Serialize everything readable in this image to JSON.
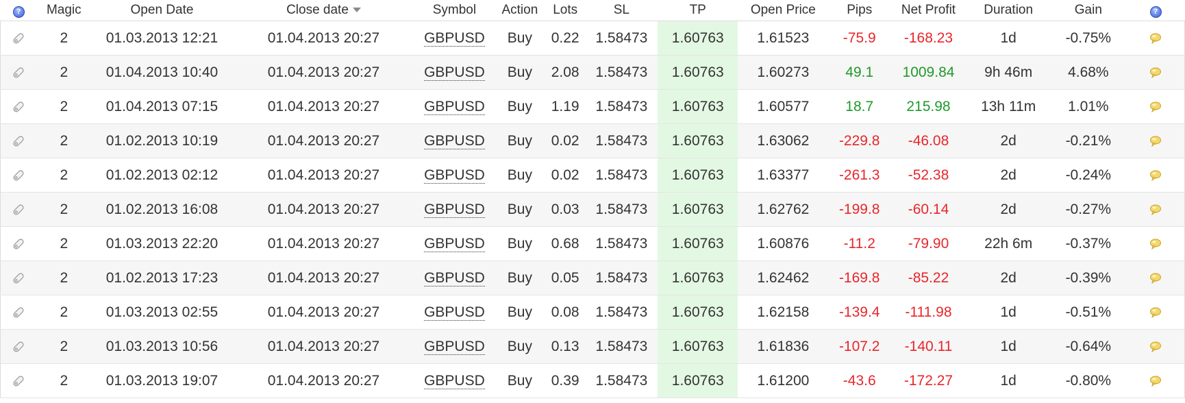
{
  "columns": {
    "magic": "Magic",
    "open_date": "Open Date",
    "close_date": "Close date",
    "symbol": "Symbol",
    "action": "Action",
    "lots": "Lots",
    "sl": "SL",
    "tp": "TP",
    "open_price": "Open Price",
    "pips": "Pips",
    "net_profit": "Net Profit",
    "duration": "Duration",
    "gain": "Gain",
    "help_icon_glyph": "?"
  },
  "sort": {
    "column": "close_date",
    "direction": "descending"
  },
  "colors": {
    "negative": "#e8262b",
    "positive": "#1f9a2a",
    "tp_highlight": "#e3f8e3",
    "help_icon": "#3a5fd6"
  },
  "icons": {
    "row_lead": "tag-icon",
    "row_trail": "comment-icon",
    "header_help": "help-icon"
  },
  "rows": [
    {
      "magic": "2",
      "open_date": "01.03.2013 12:21",
      "close_date": "01.04.2013 20:27",
      "symbol": "GBPUSD",
      "action": "Buy",
      "lots": "0.22",
      "sl": "1.58473",
      "tp": "1.60763",
      "open_price": "1.61523",
      "pips": "-75.9",
      "net_profit": "-168.23",
      "duration": "1d",
      "gain": "-0.75%"
    },
    {
      "magic": "2",
      "open_date": "01.04.2013 10:40",
      "close_date": "01.04.2013 20:27",
      "symbol": "GBPUSD",
      "action": "Buy",
      "lots": "2.08",
      "sl": "1.58473",
      "tp": "1.60763",
      "open_price": "1.60273",
      "pips": "49.1",
      "net_profit": "1009.84",
      "duration": "9h 46m",
      "gain": "4.68%"
    },
    {
      "magic": "2",
      "open_date": "01.04.2013 07:15",
      "close_date": "01.04.2013 20:27",
      "symbol": "GBPUSD",
      "action": "Buy",
      "lots": "1.19",
      "sl": "1.58473",
      "tp": "1.60763",
      "open_price": "1.60577",
      "pips": "18.7",
      "net_profit": "215.98",
      "duration": "13h 11m",
      "gain": "1.01%"
    },
    {
      "magic": "2",
      "open_date": "01.02.2013 10:19",
      "close_date": "01.04.2013 20:27",
      "symbol": "GBPUSD",
      "action": "Buy",
      "lots": "0.02",
      "sl": "1.58473",
      "tp": "1.60763",
      "open_price": "1.63062",
      "pips": "-229.8",
      "net_profit": "-46.08",
      "duration": "2d",
      "gain": "-0.21%"
    },
    {
      "magic": "2",
      "open_date": "01.02.2013 02:12",
      "close_date": "01.04.2013 20:27",
      "symbol": "GBPUSD",
      "action": "Buy",
      "lots": "0.02",
      "sl": "1.58473",
      "tp": "1.60763",
      "open_price": "1.63377",
      "pips": "-261.3",
      "net_profit": "-52.38",
      "duration": "2d",
      "gain": "-0.24%"
    },
    {
      "magic": "2",
      "open_date": "01.02.2013 16:08",
      "close_date": "01.04.2013 20:27",
      "symbol": "GBPUSD",
      "action": "Buy",
      "lots": "0.03",
      "sl": "1.58473",
      "tp": "1.60763",
      "open_price": "1.62762",
      "pips": "-199.8",
      "net_profit": "-60.14",
      "duration": "2d",
      "gain": "-0.27%"
    },
    {
      "magic": "2",
      "open_date": "01.03.2013 22:20",
      "close_date": "01.04.2013 20:27",
      "symbol": "GBPUSD",
      "action": "Buy",
      "lots": "0.68",
      "sl": "1.58473",
      "tp": "1.60763",
      "open_price": "1.60876",
      "pips": "-11.2",
      "net_profit": "-79.90",
      "duration": "22h 6m",
      "gain": "-0.37%"
    },
    {
      "magic": "2",
      "open_date": "01.02.2013 17:23",
      "close_date": "01.04.2013 20:27",
      "symbol": "GBPUSD",
      "action": "Buy",
      "lots": "0.05",
      "sl": "1.58473",
      "tp": "1.60763",
      "open_price": "1.62462",
      "pips": "-169.8",
      "net_profit": "-85.22",
      "duration": "2d",
      "gain": "-0.39%"
    },
    {
      "magic": "2",
      "open_date": "01.03.2013 02:55",
      "close_date": "01.04.2013 20:27",
      "symbol": "GBPUSD",
      "action": "Buy",
      "lots": "0.08",
      "sl": "1.58473",
      "tp": "1.60763",
      "open_price": "1.62158",
      "pips": "-139.4",
      "net_profit": "-111.98",
      "duration": "1d",
      "gain": "-0.51%"
    },
    {
      "magic": "2",
      "open_date": "01.03.2013 10:56",
      "close_date": "01.04.2013 20:27",
      "symbol": "GBPUSD",
      "action": "Buy",
      "lots": "0.13",
      "sl": "1.58473",
      "tp": "1.60763",
      "open_price": "1.61836",
      "pips": "-107.2",
      "net_profit": "-140.11",
      "duration": "1d",
      "gain": "-0.64%"
    },
    {
      "magic": "2",
      "open_date": "01.03.2013 19:07",
      "close_date": "01.04.2013 20:27",
      "symbol": "GBPUSD",
      "action": "Buy",
      "lots": "0.39",
      "sl": "1.58473",
      "tp": "1.60763",
      "open_price": "1.61200",
      "pips": "-43.6",
      "net_profit": "-172.27",
      "duration": "1d",
      "gain": "-0.80%"
    }
  ]
}
